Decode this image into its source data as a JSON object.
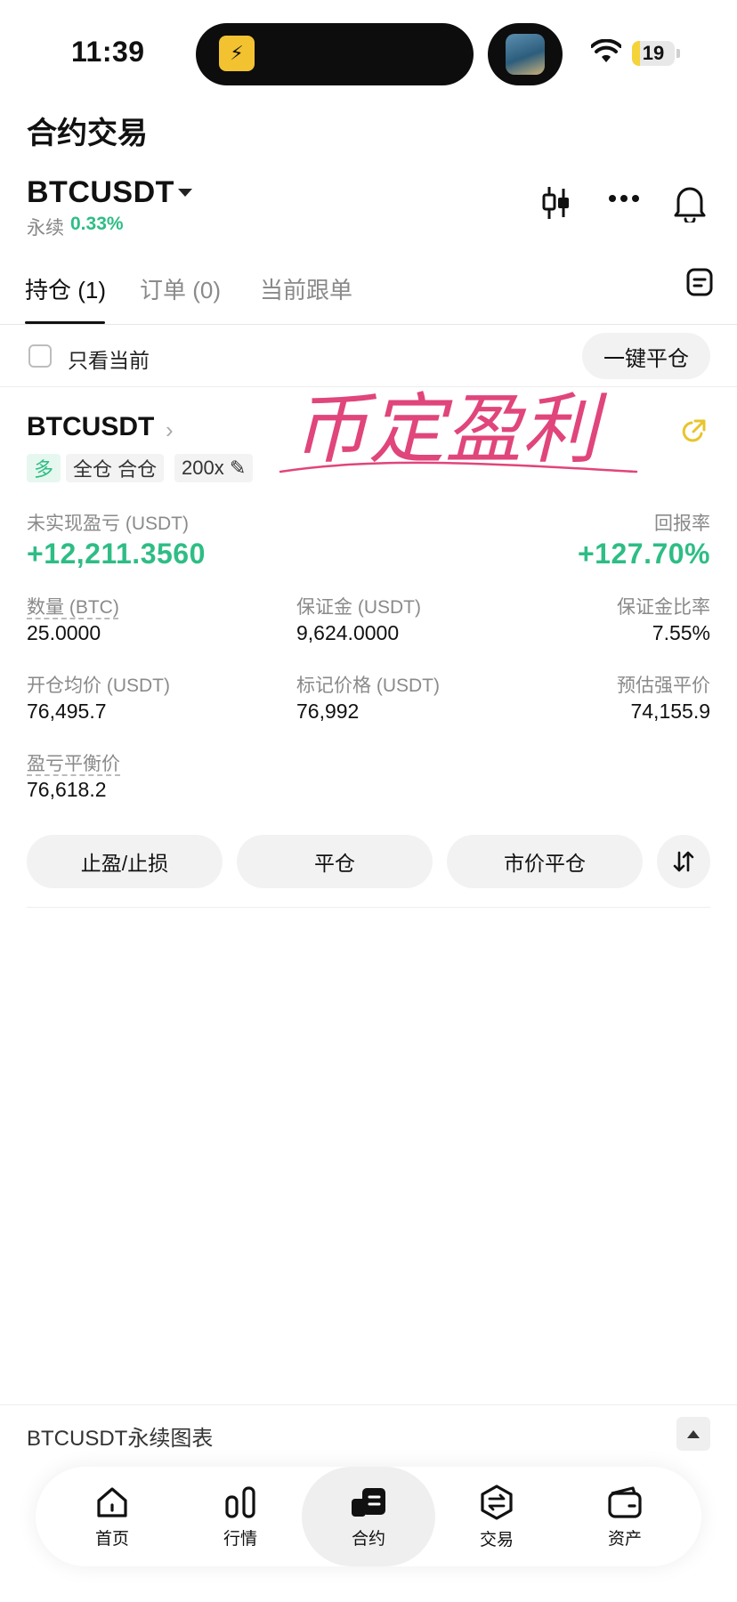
{
  "status_bar": {
    "time": "11:39",
    "battery": "19",
    "battery_fraction": 0.19
  },
  "header": {
    "title": "合约交易",
    "symbol": "BTCUSDT",
    "contract_type": "永续",
    "change": "0.33%"
  },
  "tabs": [
    {
      "label": "持仓 (1)",
      "active": true
    },
    {
      "label": "订单 (0)",
      "active": false
    },
    {
      "label": "当前跟单",
      "active": false
    }
  ],
  "filter": {
    "only_current_label": "只看当前",
    "close_all_label": "一键平仓"
  },
  "position": {
    "symbol": "BTCUSDT",
    "tags": {
      "side": "多",
      "margin_mode": "全仓 合仓",
      "leverage": "200x ✎"
    },
    "unrealized_pnl": {
      "label": "未实现盈亏 (USDT)",
      "value": "+12,211.3560"
    },
    "roe": {
      "label": "回报率",
      "value": "+127.70%"
    },
    "quantity": {
      "label": "数量 (BTC)",
      "value": "25.0000"
    },
    "margin": {
      "label": "保证金 (USDT)",
      "value": "9,624.0000"
    },
    "margin_ratio": {
      "label": "保证金比率",
      "value": "7.55%"
    },
    "entry_price": {
      "label": "开仓均价 (USDT)",
      "value": "76,495.7"
    },
    "mark_price": {
      "label": "标记价格 (USDT)",
      "value": "76,992"
    },
    "liq_price": {
      "label": "预估强平价",
      "value": "74,155.9"
    },
    "breakeven": {
      "label": "盈亏平衡价",
      "value": "76,618.2"
    },
    "buttons": {
      "tp_sl": "止盈/止损",
      "close": "平仓",
      "market_close": "市价平仓"
    }
  },
  "watermark": "币定盈利",
  "chart_bar": {
    "label": "BTCUSDT永续图表"
  },
  "bottom_nav": [
    {
      "label": "首页",
      "icon": "home-icon"
    },
    {
      "label": "行情",
      "icon": "market-bars-icon"
    },
    {
      "label": "合约",
      "icon": "contract-icon",
      "active": true
    },
    {
      "label": "交易",
      "icon": "trade-hex-icon"
    },
    {
      "label": "资产",
      "icon": "wallet-icon"
    }
  ],
  "colors": {
    "green": "#2ebd85",
    "text": "#111111",
    "muted": "#8a8a8a",
    "pink": "#e0457b"
  }
}
